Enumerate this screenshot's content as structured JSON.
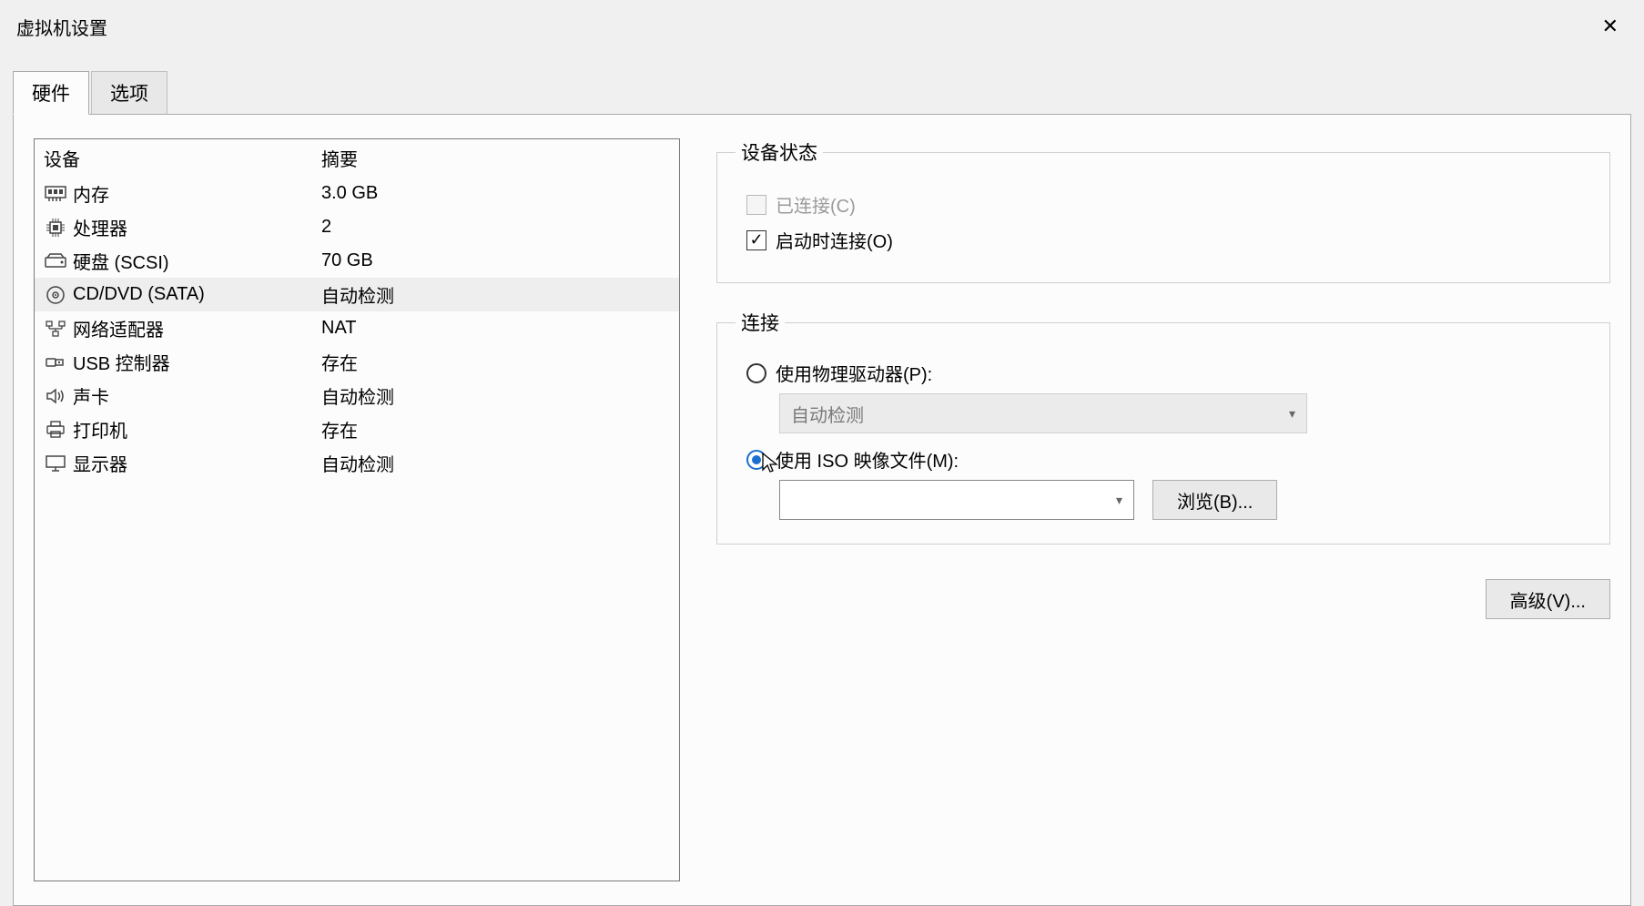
{
  "titlebar": {
    "title": "虚拟机设置"
  },
  "tabs": {
    "hardware": "硬件",
    "options": "选项"
  },
  "device_table": {
    "header_device": "设备",
    "header_summary": "摘要",
    "rows": [
      {
        "icon": "memory",
        "name": "内存",
        "summary": "3.0 GB"
      },
      {
        "icon": "cpu",
        "name": "处理器",
        "summary": "2"
      },
      {
        "icon": "disk",
        "name": "硬盘 (SCSI)",
        "summary": "70 GB"
      },
      {
        "icon": "cd",
        "name": "CD/DVD (SATA)",
        "summary": "自动检测"
      },
      {
        "icon": "network",
        "name": "网络适配器",
        "summary": "NAT"
      },
      {
        "icon": "usb",
        "name": "USB 控制器",
        "summary": "存在"
      },
      {
        "icon": "sound",
        "name": "声卡",
        "summary": "自动检测"
      },
      {
        "icon": "printer",
        "name": "打印机",
        "summary": "存在"
      },
      {
        "icon": "display",
        "name": "显示器",
        "summary": "自动检测"
      }
    ]
  },
  "device_status": {
    "legend": "设备状态",
    "connected": "已连接(C)",
    "connect_at_poweron": "启动时连接(O)"
  },
  "connection": {
    "legend": "连接",
    "physical": "使用物理驱动器(P):",
    "physical_value": "自动检测",
    "iso": "使用 ISO 映像文件(M):",
    "iso_value": "",
    "browse": "浏览(B)..."
  },
  "advanced_btn": "高级(V)..."
}
